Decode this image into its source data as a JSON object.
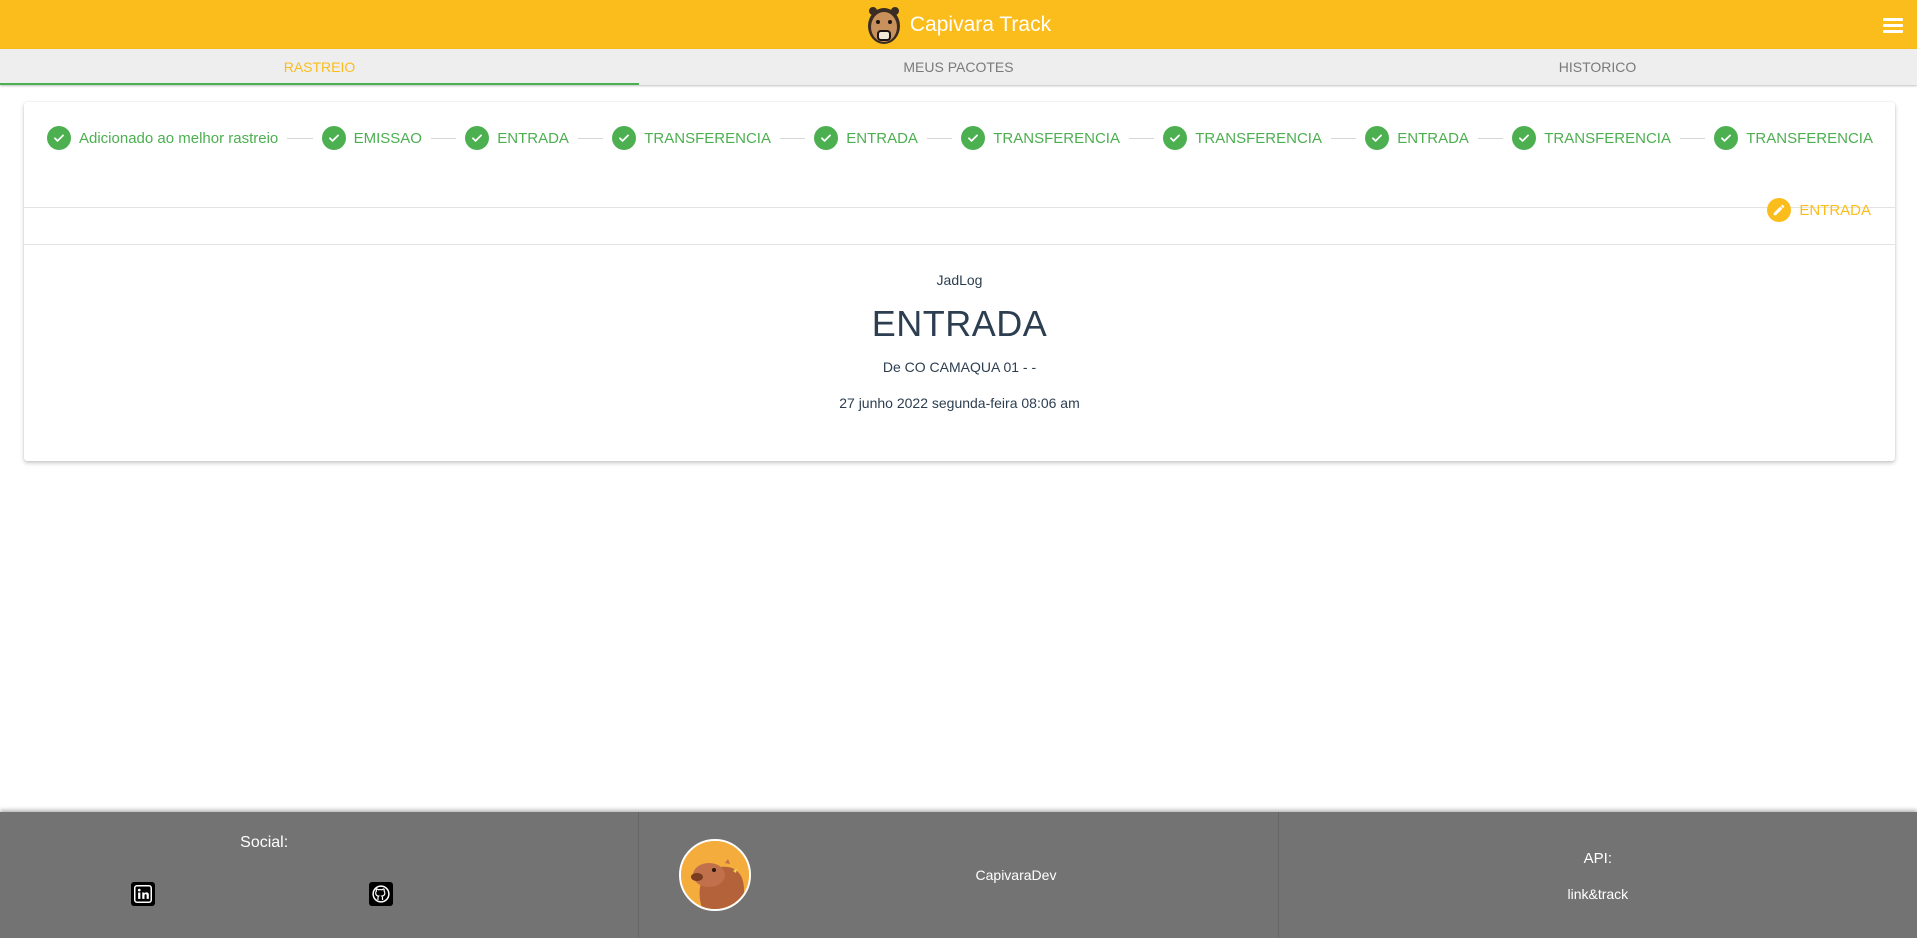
{
  "header": {
    "title": "Capivara Track",
    "logo_icon": "capybara-logo",
    "menu_icon": "hamburger-menu-icon",
    "background_color": "#fbbd1c"
  },
  "tabs": [
    {
      "label": "RASTREIO",
      "active": true
    },
    {
      "label": "MEUS PACOTES",
      "active": false
    },
    {
      "label": "HISTORICO",
      "active": false
    }
  ],
  "stepper": {
    "completed_color": "#4caf50",
    "current_color": "#fbbd1c",
    "steps": [
      {
        "label": "Adicionado ao melhor rastreio",
        "status": "done"
      },
      {
        "label": "EMISSAO",
        "status": "done"
      },
      {
        "label": "ENTRADA",
        "status": "done"
      },
      {
        "label": "TRANSFERENCIA",
        "status": "done"
      },
      {
        "label": "ENTRADA",
        "status": "done"
      },
      {
        "label": "TRANSFERENCIA",
        "status": "done"
      },
      {
        "label": "TRANSFERENCIA",
        "status": "done"
      },
      {
        "label": "ENTRADA",
        "status": "done"
      },
      {
        "label": "TRANSFERENCIA",
        "status": "done"
      },
      {
        "label": "TRANSFERENCIA",
        "status": "done"
      }
    ],
    "current": {
      "label": "ENTRADA",
      "status": "editing",
      "icon": "pencil-icon"
    }
  },
  "detail": {
    "carrier": "JadLog",
    "event": "ENTRADA",
    "origin": "De CO CAMAQUA 01 - -",
    "datetime": "27 junho 2022 segunda-feira 08:06 am"
  },
  "footer": {
    "social_title": "Social:",
    "social_icons": [
      "linkedin-icon",
      "github-icon"
    ],
    "developer_name": "CapivaraDev",
    "avatar_icon": "capybara-avatar",
    "api_title": "API:",
    "api_link": "link&track",
    "background_color": "#737373"
  }
}
